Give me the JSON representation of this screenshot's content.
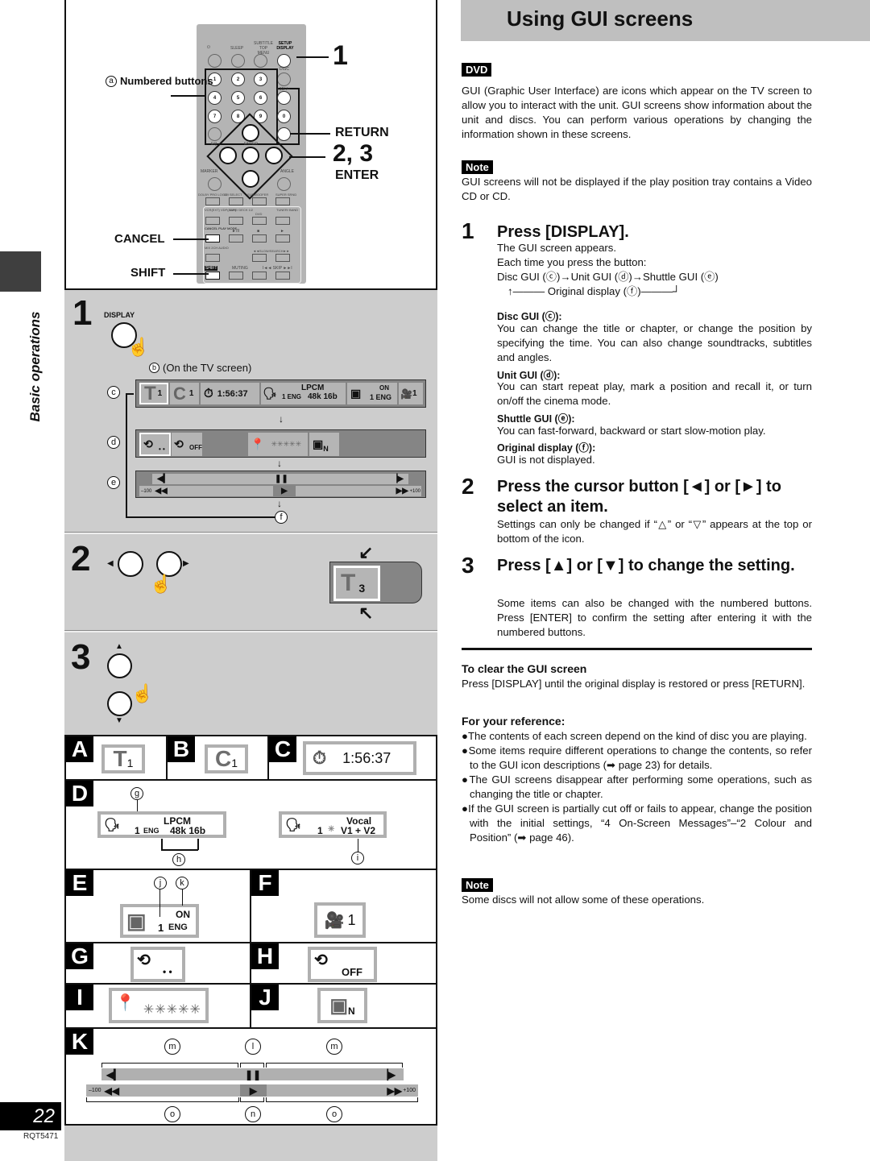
{
  "page": {
    "section_label": "Basic operations",
    "page_number": "22",
    "doc_code": "RQT5471"
  },
  "remote": {
    "callouts": {
      "numbered_marker": "a",
      "numbered_buttons": "Numbered buttons",
      "step1": "1",
      "return": "RETURN",
      "step23": "2, 3",
      "enter": "ENTER",
      "cancel": "CANCEL",
      "shift": "SHIFT"
    },
    "top_labels": [
      "⏻",
      "SLEEP",
      "SUBTITLE TOP MENU",
      "SETUP DISPLAY"
    ],
    "disc_label": "DISC",
    "numbers": [
      "1",
      "2",
      "3",
      "4",
      "5",
      "6",
      "7",
      "8",
      "9",
      "0"
    ],
    "plus10_label": "≥10/-/--",
    "menu_label": "MENU",
    "eq_label": "EQ",
    "enter_label": "ENTER",
    "return_label": "RETURN",
    "marker_label": "MARKER",
    "angle_label": "ANGLE",
    "row_labels_1": [
      "DOLBY PRO LOGIC",
      "CH SELECT",
      "SUBWOOFER",
      "SUPER SRND"
    ],
    "row_labels_2": [
      "VCR(EXT) VDP(AUX)",
      "TAPE/ DECK 1/2",
      "DVD",
      "TUNER/ BAND"
    ],
    "row_labels_3": [
      "CANCEL PLAY MODE",
      "►/II",
      "■",
      "►"
    ],
    "row_labels_4": [
      "MIX 2CH AUDIO",
      "◄◄SLOW/SEARCH►►"
    ],
    "row_labels_5": [
      "SHIFT",
      "MUTING",
      "I◄◄ SKIP ►►I"
    ]
  },
  "step1": {
    "number": "1",
    "button_label": "DISPLAY",
    "tv_marker": "b",
    "tv_caption": "(On the TV screen)",
    "markers": [
      "c",
      "d",
      "e",
      "f"
    ],
    "disc_gui": {
      "title_value": "1",
      "chapter_value": "1",
      "time": "1:56:37",
      "audio_format": "LPCM",
      "audio_track": "1 ENG",
      "audio_detail": "48k 16b",
      "subtitle_state": "ON",
      "subtitle_track": "1 ENG",
      "angle_value": "1"
    },
    "unit_gui": {
      "repeat_a": "• •",
      "repeat_b": "OFF",
      "marker_stars": "✳✳✳✳✳",
      "cinema_mode": "N"
    },
    "shuttle_gui": {
      "min_label": "–100",
      "max_label": "+100"
    }
  },
  "step2": {
    "number": "2",
    "title_value": "3"
  },
  "step3": {
    "number": "3"
  },
  "grid": {
    "A": {
      "letter": "A",
      "value": "1"
    },
    "B": {
      "letter": "B",
      "value": "1"
    },
    "C": {
      "letter": "C",
      "time": "1:56:37"
    },
    "D": {
      "letter": "D",
      "markers": [
        "g",
        "h",
        "i"
      ],
      "left": {
        "format": "LPCM",
        "track": "1",
        "lang": "ENG",
        "detail": "48k 16b"
      },
      "right": {
        "format": "Vocal",
        "track": "1",
        "star": "✳",
        "detail": "V1 + V2"
      }
    },
    "E": {
      "letter": "E",
      "markers": [
        "j",
        "k"
      ],
      "state": "ON",
      "track": "1",
      "lang": "ENG"
    },
    "F": {
      "letter": "F",
      "value": "1"
    },
    "G": {
      "letter": "G",
      "value": "• •"
    },
    "H": {
      "letter": "H",
      "value": "OFF"
    },
    "I": {
      "letter": "I",
      "value": "✳✳✳✳✳"
    },
    "J": {
      "letter": "J",
      "value": "N"
    },
    "K": {
      "letter": "K",
      "top_markers": [
        "m",
        "l",
        "m"
      ],
      "bottom_markers": [
        "o",
        "n",
        "o"
      ],
      "min_label": "–100",
      "max_label": "+100"
    }
  },
  "right": {
    "title": "Using GUI screens",
    "dvd_tag": "DVD",
    "intro": "GUI (Graphic User Interface) are icons which appear on the TV screen to allow you to interact with the unit. GUI screens show information about the unit and discs. You can perform various operations by changing the information shown in these screens.",
    "note1_tag": "Note",
    "note1": "GUI screens will not be displayed if the play position tray contains a Video CD or CD.",
    "step1": {
      "number": "1",
      "heading": "Press [DISPLAY].",
      "line1": "The GUI screen appears.",
      "line2": "Each time you press the button:",
      "cycle": "Disc GUI (ⓒ)→Unit GUI (ⓓ)→Shuttle GUI (ⓔ)",
      "cycle_back": "↑——— Original display (ⓕ)———┘",
      "items": [
        {
          "label": "Disc GUI (ⓒ):",
          "text": "You can change the title or chapter, or change the position by specifying the time. You can also change soundtracks, subtitles and angles."
        },
        {
          "label": "Unit GUI (ⓓ):",
          "text": "You can start repeat play, mark a position and recall it, or turn on/off the cinema mode."
        },
        {
          "label": "Shuttle GUI (ⓔ):",
          "text": "You can fast-forward, backward or start slow-motion play."
        },
        {
          "label": "Original display (ⓕ):",
          "text": "GUI is not displayed."
        }
      ]
    },
    "step2": {
      "number": "2",
      "heading": "Press the cursor button [◄] or [►] to select an item.",
      "text": "Settings can only be changed if “△” or “▽” appears at the top or bottom of the icon."
    },
    "step3": {
      "number": "3",
      "heading": "Press [▲] or [▼] to change the setting.",
      "text": "Some items can also be changed with the numbered buttons. Press [ENTER] to confirm the setting after entering it with the numbered buttons."
    },
    "clear": {
      "heading": "To clear the GUI screen",
      "text": "Press [DISPLAY] until the original display is restored or press [RETURN]."
    },
    "reference": {
      "heading": "For your reference:",
      "bullets": [
        "●The contents of each screen depend on the kind of disc you are playing.",
        "●Some items require different operations to change the contents, so refer to the GUI icon descriptions (➡ page 23) for details.",
        "●The GUI screens disappear after performing some operations, such as changing the title or chapter.",
        "●If the GUI screen is partially cut off or fails to appear, change the position with the initial settings, “4 On-Screen Messages”–“2 Colour and Position” (➡ page 46)."
      ]
    },
    "note2_tag": "Note",
    "note2": "Some discs will not allow some of these operations."
  }
}
